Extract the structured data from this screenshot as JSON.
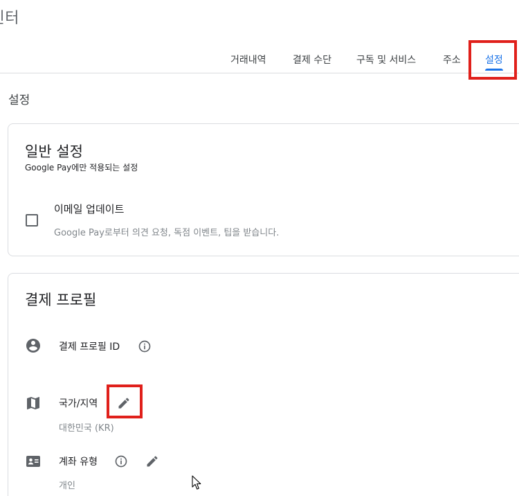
{
  "app": {
    "title": "센터"
  },
  "tabs": [
    {
      "label": "거래내역"
    },
    {
      "label": "결제 수단"
    },
    {
      "label": "구독 및 서비스"
    },
    {
      "label": "주소"
    },
    {
      "label": "설정",
      "active": true
    }
  ],
  "section": {
    "title": "설정"
  },
  "general": {
    "heading": "일반 설정",
    "subtitle": "Google Pay에만 적용되는 설정",
    "email_updates": {
      "label": "이메일 업데이트",
      "description": "Google Pay로부터 의견 요청, 독점 이벤트, 팁을 받습니다.",
      "checked": false
    }
  },
  "profile": {
    "heading": "결제 프로필",
    "profile_id": {
      "label": "결제 프로필 ID"
    },
    "country": {
      "label": "국가/지역",
      "value": "대한민국 (KR)"
    },
    "account_type": {
      "label": "계좌 유형",
      "value": "개인"
    }
  },
  "colors": {
    "accent": "#1a73e8",
    "highlight": "#e0201b",
    "icon": "#5f6368"
  }
}
